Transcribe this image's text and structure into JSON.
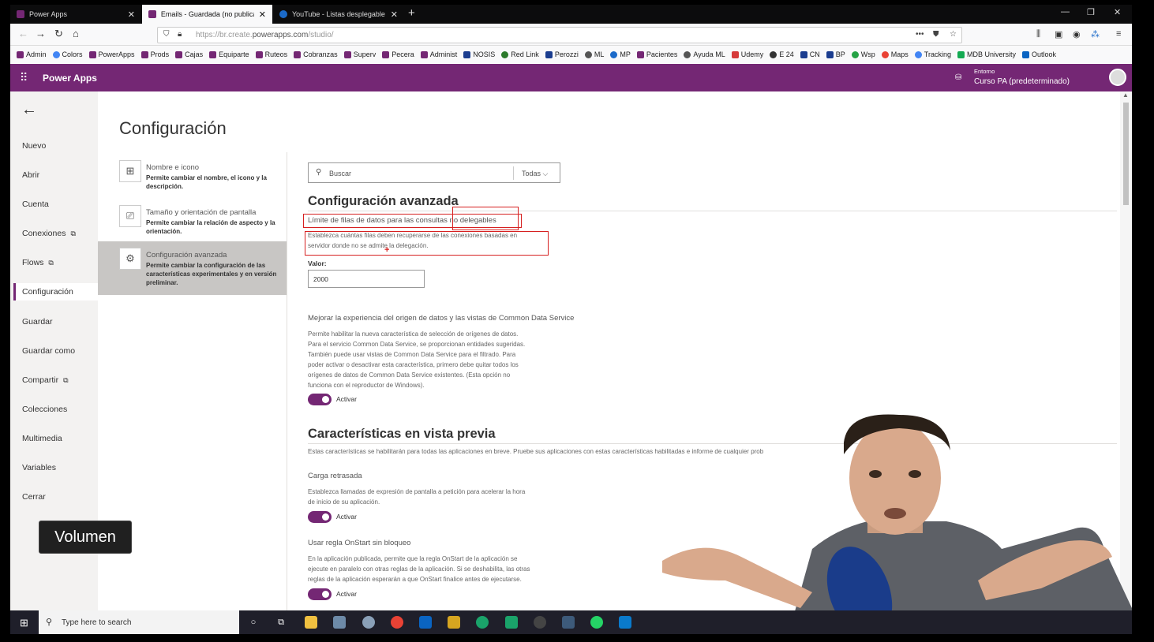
{
  "browser": {
    "tabs": [
      {
        "label": "Power Apps"
      },
      {
        "label": "Emails - Guardada (no publica"
      },
      {
        "label": "YouTube - Listas desplegables"
      }
    ],
    "url_prefix": "https://br.create.",
    "url_domain": "powerapps.com",
    "url_path": "/studio/",
    "bookmarks": [
      "Admin",
      "Colors",
      "PowerApps",
      "Prods",
      "Cajas",
      "Equiparte",
      "Ruteos",
      "Cobranzas",
      "Superv",
      "Pecera",
      "Administ",
      "NOSIS",
      "Red Link",
      "Perozzi",
      "ML",
      "MP",
      "Pacientes",
      "Ayuda ML",
      "Udemy",
      "E 24",
      "CN",
      "BP",
      "Wsp",
      "Maps",
      "Tracking",
      "MDB University",
      "Outlook"
    ]
  },
  "header": {
    "app_name": "Power Apps",
    "env_label": "Entorno",
    "env_value": "Curso PA (predeterminado)"
  },
  "leftmenu": {
    "items": [
      "Nuevo",
      "Abrir",
      "Cuenta",
      "Conexiones",
      "Flows",
      "Configuración",
      "Guardar",
      "Guardar como",
      "Compartir",
      "Colecciones",
      "Multimedia",
      "Variables",
      "Cerrar"
    ],
    "active": "Configuración"
  },
  "settings": {
    "title": "Configuración",
    "nav": [
      {
        "title": "Nombre e icono",
        "desc": "Permite cambiar el nombre, el icono y la descripción."
      },
      {
        "title": "Tamaño y orientación de pantalla",
        "desc": "Permite cambiar la relación de aspecto y la orientación."
      },
      {
        "title": "Configuración avanzada",
        "desc": "Permite cambiar la configuración de las características experimentales y en versión preliminar."
      }
    ],
    "search_placeholder": "Buscar",
    "filter": "Todas"
  },
  "advanced": {
    "heading": "Configuración avanzada",
    "row_limit_title": "Límite de filas de datos para las consultas no delegables",
    "row_limit_desc1": "Establezca cuántas filas deben recuperarse de las conexiones basadas en",
    "row_limit_desc2": "servidor donde no se admite la delegación.",
    "value_label": "Valor:",
    "value": "2000",
    "cds_title": "Mejorar la experiencia del origen de datos y las vistas de Common Data Service",
    "cds_desc": [
      "Permite habilitar la nueva característica de selección de orígenes de datos.",
      "Para el servicio Common Data Service, se proporcionan entidades sugeridas.",
      "También puede usar vistas de Common Data Service para el filtrado. Para",
      "poder activar o desactivar esta característica, primero debe quitar todos los",
      "orígenes de datos de Common Data Service existentes. (Esta opción no",
      "funciona con el reproductor de Windows)."
    ],
    "toggle_label": "Activar"
  },
  "preview": {
    "heading": "Características en vista previa",
    "desc": "Estas características se habilitarán para todas las aplicaciones en breve. Pruebe sus aplicaciones con estas características habilitadas e informe de cualquier prob",
    "delayed_title": "Carga retrasada",
    "delayed_desc": [
      "Establezca llamadas de expresión de pantalla a petición para acelerar la hora",
      "de inicio de su aplicación."
    ],
    "onstart_title": "Usar regla OnStart sin bloqueo",
    "onstart_desc": [
      "En la aplicación publicada, permite que la regla OnStart de la aplicación se",
      "ejecute en paralelo con otras reglas de la aplicación. Si se deshabilita, las otras",
      "reglas de la aplicación esperarán a que OnStart finalice antes de ejecutarse."
    ],
    "toggle_label": "Activar"
  },
  "overlay": {
    "volume": "Volumen"
  },
  "taskbar": {
    "search_placeholder": "Type here to search"
  },
  "colors": {
    "brand": "#742774",
    "highlight": "#d62020"
  }
}
